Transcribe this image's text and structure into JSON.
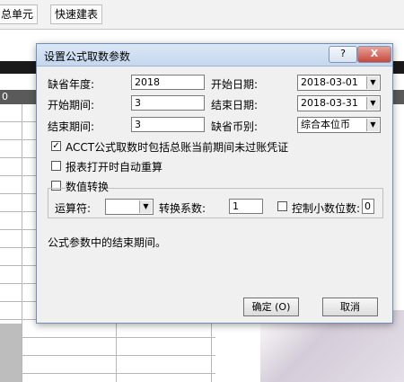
{
  "toolbar": {
    "btn_summary_cell": "总单元",
    "btn_quick_build": "快速建表"
  },
  "sheet": {
    "marker": "0"
  },
  "dialog": {
    "title": "设置公式取数参数",
    "help_symbol": "?",
    "close_symbol": "X",
    "default_year_label": "缺省年度:",
    "default_year_value": "2018",
    "start_date_label": "开始日期:",
    "start_date_value": "2018-03-01",
    "start_period_label": "开始期间:",
    "start_period_value": "3",
    "end_date_label": "结束日期:",
    "end_date_value": "2018-03-31",
    "end_period_label": "结束期间:",
    "end_period_value": "3",
    "default_currency_label": "缺省币别:",
    "default_currency_value": "综合本位币",
    "acct_include_label": "ACCT公式取数时包括总账当前期间未过账凭证",
    "acct_include_checked": true,
    "auto_recalc_label": "报表打开时自动重算",
    "auto_recalc_checked": false,
    "value_convert_label": "数值转换",
    "value_convert_checked": false,
    "operator_label": "运算符:",
    "operator_value": "",
    "convert_factor_label": "转换系数:",
    "convert_factor_value": "1",
    "decimal_control_label": "控制小数位数:",
    "decimal_control_value": "0",
    "decimal_control_checked": false,
    "hint_text": "公式参数中的结束期间。",
    "ok_label": "确定 (O)",
    "cancel_label": "取消"
  }
}
